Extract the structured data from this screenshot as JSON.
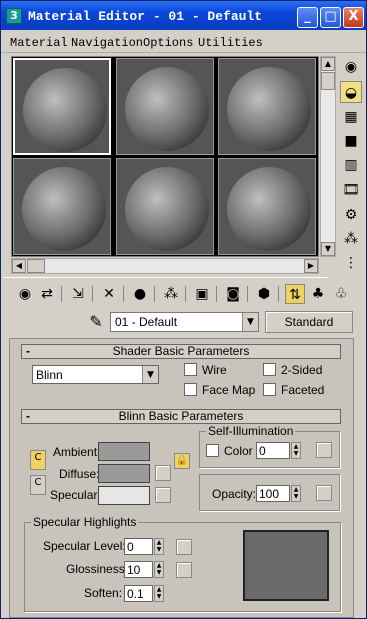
{
  "window": {
    "title": "Material Editor - 01 - Default",
    "app_icon": "3",
    "min_label": "_",
    "max_label": "□",
    "close_label": "X"
  },
  "menu": [
    "Material",
    "Navigation",
    "Options",
    "Utilities"
  ],
  "slots": {
    "count": 6,
    "selected_index": 0
  },
  "side_tools": [
    "sample-type-icon",
    "backlight-icon",
    "background-icon",
    "uv-tiling-icon",
    "video-color-check-icon",
    "make-preview-icon",
    "options-icon",
    "select-by-material-icon",
    "material-navigator-icon"
  ],
  "toolbar_tools": [
    "get-material-icon",
    "put-to-scene-icon",
    "assign-to-selection-icon",
    "reset-icon",
    "make-copy-icon",
    "make-unique-icon",
    "put-to-library-icon",
    "material-id-channel-icon",
    "show-map-icon",
    "show-end-result-icon",
    "go-to-parent-icon",
    "go-forward-icon"
  ],
  "material": {
    "name": "01 - Default",
    "type_button": "Standard"
  },
  "shader_rollout": {
    "title": "Shader Basic Parameters",
    "shader": "Blinn",
    "options": [
      "Wire",
      "2-Sided",
      "Face Map",
      "Faceted"
    ]
  },
  "blinn_rollout": {
    "title": "Blinn Basic Parameters",
    "ambient_label": "Ambient:",
    "diffuse_label": "Diffuse:",
    "specular_label": "Specular:",
    "ambient_color": "#9a9a9a",
    "diffuse_color": "#9a9a9a",
    "specular_color": "#e6e6e6",
    "self_illum": {
      "title": "Self-Illumination",
      "color_label": "Color",
      "value": "0"
    },
    "opacity": {
      "label": "Opacity:",
      "value": "100"
    }
  },
  "specular_highlights": {
    "title": "Specular Highlights",
    "level_label": "Specular Level:",
    "level_value": "0",
    "gloss_label": "Glossiness:",
    "gloss_value": "10",
    "soften_label": "Soften:",
    "soften_value": "0.1"
  }
}
